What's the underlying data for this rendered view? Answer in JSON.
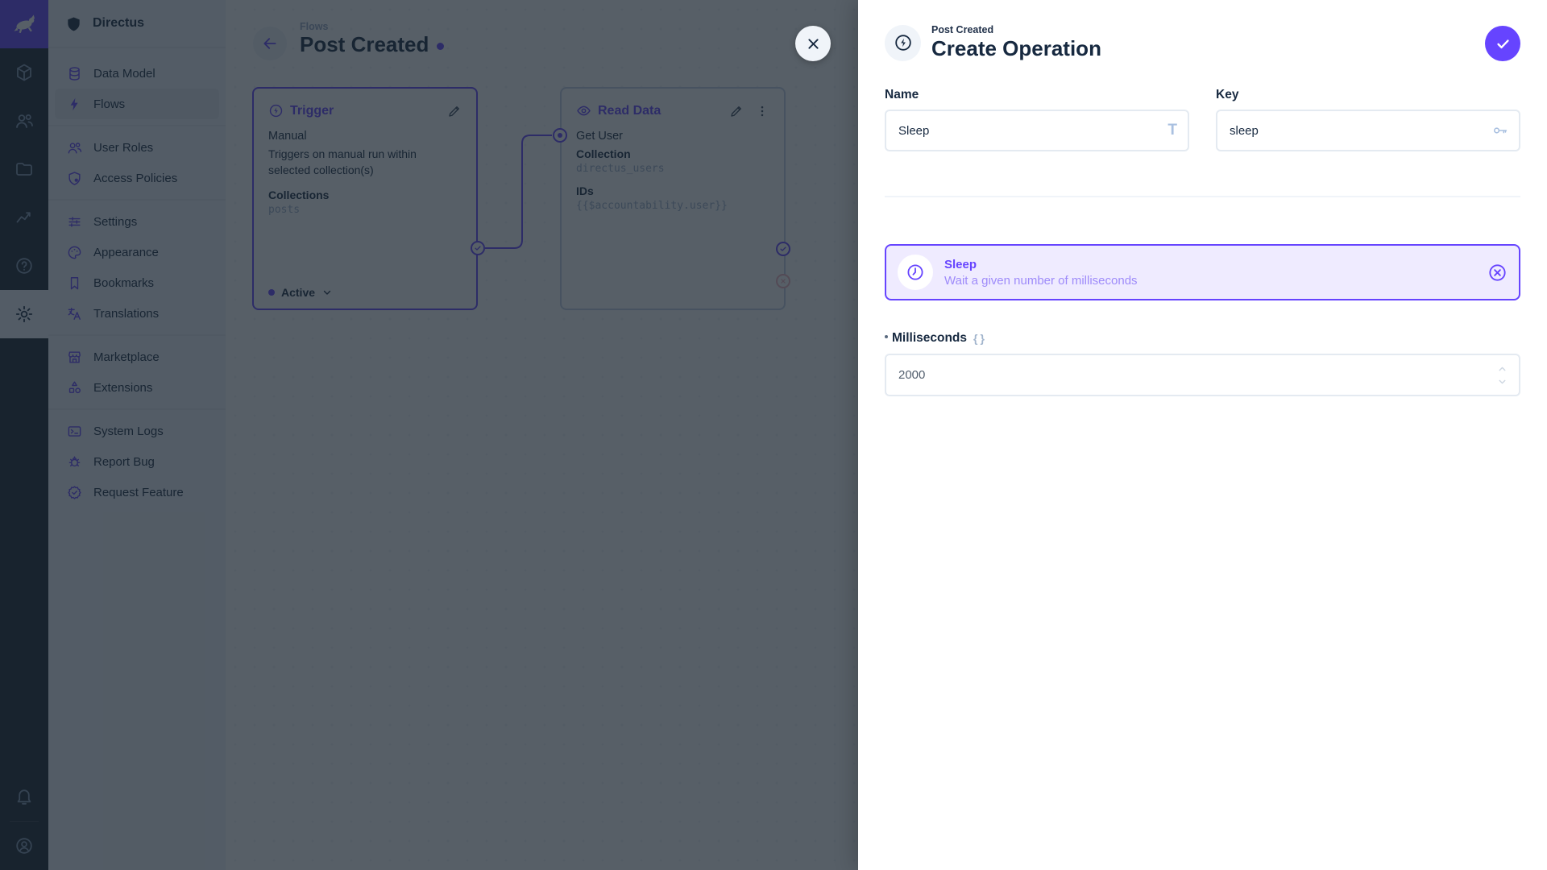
{
  "app": {
    "accent_color": "#6644ff",
    "navy_color": "#172940",
    "muted_color": "#a2b5cd",
    "danger_color": "#e35169",
    "module_bar_color": "#18222f",
    "card_bg_color": "#efebff"
  },
  "sidebar": {
    "project": "Directus",
    "items": [
      {
        "label": "Data Model",
        "icon": "database-icon"
      },
      {
        "label": "Flows",
        "icon": "bolt-icon",
        "active": true
      },
      {
        "label": "User Roles",
        "icon": "users-icon"
      },
      {
        "label": "Access Policies",
        "icon": "shield-lock-icon"
      },
      {
        "label": "Settings",
        "icon": "tune-icon"
      },
      {
        "label": "Appearance",
        "icon": "palette-icon"
      },
      {
        "label": "Bookmarks",
        "icon": "bookmark-icon"
      },
      {
        "label": "Translations",
        "icon": "translate-icon"
      },
      {
        "label": "Marketplace",
        "icon": "storefront-icon"
      },
      {
        "label": "Extensions",
        "icon": "extension-icon"
      },
      {
        "label": "System Logs",
        "icon": "terminal-icon"
      },
      {
        "label": "Report Bug",
        "icon": "bug-icon"
      },
      {
        "label": "Request Feature",
        "icon": "feature-check-icon"
      }
    ]
  },
  "canvas": {
    "breadcrumb": "Flows",
    "title": "Post Created",
    "trigger": {
      "title": "Trigger",
      "type": "Manual",
      "description": "Triggers on manual run within selected collection(s)",
      "option_label": "Collections",
      "option_value": "posts",
      "status": "Active"
    },
    "read_data": {
      "title": "Read Data",
      "name": "Get User",
      "option1_label": "Collection",
      "option1_value": "directus_users",
      "option2_label": "IDs",
      "option2_value": "{{$accountability.user}}"
    }
  },
  "drawer": {
    "breadcrumb": "Post Created",
    "title": "Create Operation",
    "name_label": "Name",
    "name_value": "Sleep",
    "name_icon_glyph": "T",
    "key_label": "Key",
    "key_value": "sleep",
    "operation": {
      "title": "Sleep",
      "description": "Wait a given number of milliseconds"
    },
    "ms_label": "Milliseconds",
    "ms_raw_glyph": "{}",
    "ms_value": "2000"
  }
}
